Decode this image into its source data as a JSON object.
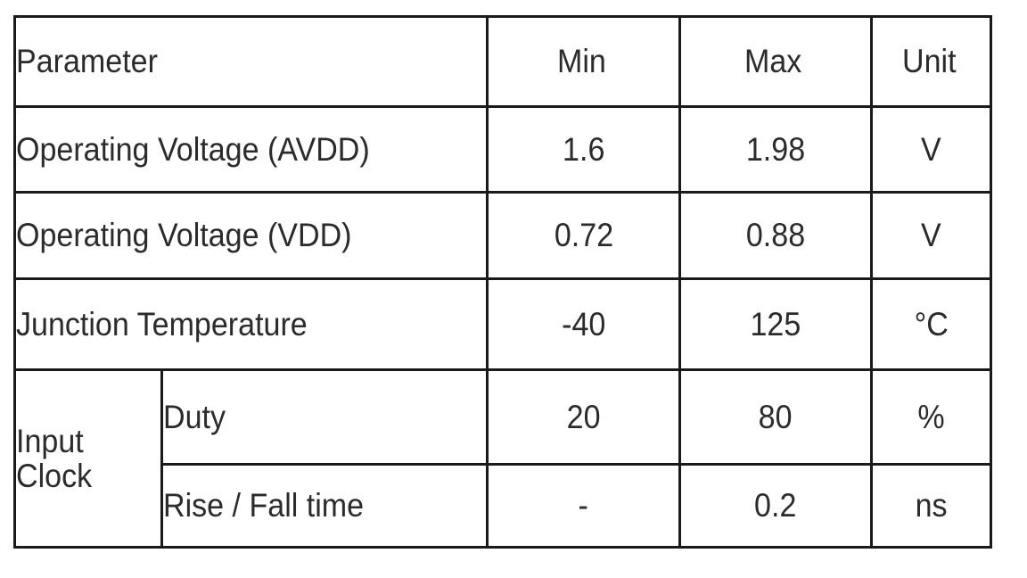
{
  "table": {
    "name": "electrical-specifications-table",
    "columns": [
      {
        "key": "parameter",
        "label": "Parameter",
        "align": "left"
      },
      {
        "key": "min",
        "label": "Min",
        "align": "center"
      },
      {
        "key": "max",
        "label": "Max",
        "align": "center"
      },
      {
        "key": "unit",
        "label": "Unit",
        "align": "center"
      }
    ],
    "header": {
      "parameter": "Parameter",
      "min": "Min",
      "max": "Max",
      "unit": "Unit"
    },
    "rows": [
      {
        "parameter": "Operating Voltage (AVDD)",
        "min": "1.6",
        "max": "1.98",
        "unit": "V"
      },
      {
        "parameter": "Operating Voltage (VDD)",
        "min": "0.72",
        "max": "0.88",
        "unit": "V"
      },
      {
        "parameter": "Junction Temperature",
        "min": "-40",
        "max": "125",
        "unit": "°C"
      },
      {
        "group": "Input Clock",
        "parameter": "Duty",
        "min": "20",
        "max": "80",
        "unit": "%"
      },
      {
        "group": "Input Clock",
        "parameter": "Rise / Fall time",
        "min": "-",
        "max": "0.2",
        "unit": "ns"
      }
    ],
    "group_label": "Input Clock"
  },
  "style": {
    "border_color": "#1a1a1a",
    "text_color": "#2b2b2b",
    "header_text_color": "#1f1f1f",
    "background": "#ffffff"
  }
}
